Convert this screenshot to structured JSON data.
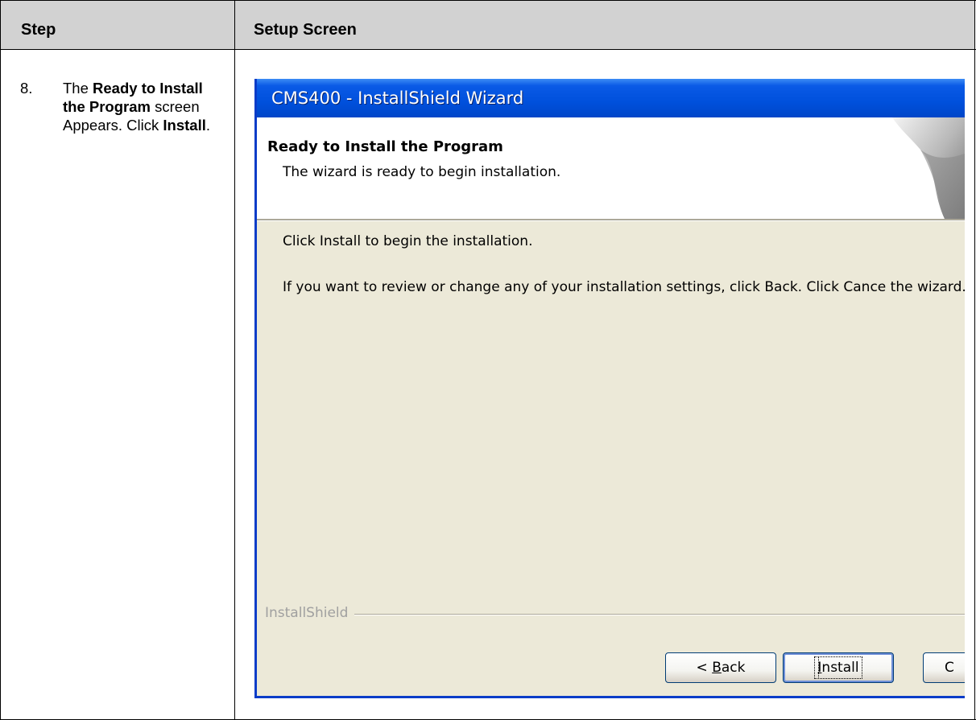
{
  "table": {
    "header": {
      "step": "Step",
      "setup_screen": "Setup Screen"
    },
    "row": {
      "number": "8.",
      "text_parts": [
        "The ",
        "Ready to Install the Program",
        " screen Appears. Click ",
        "Install",
        "."
      ]
    }
  },
  "wizard": {
    "title": "CMS400 - InstallShield Wizard",
    "banner_title": "Ready to Install the Program",
    "banner_subtitle": "The wizard is ready to begin installation.",
    "body_line1": "Click Install to begin the installation.",
    "body_line2": "If you want to review or change any of your installation settings, click Back. Click Cance the wizard.",
    "footer_brand": "InstallShield",
    "buttons": {
      "back": {
        "prefix": "< ",
        "accel": "B",
        "rest": "ack"
      },
      "install": {
        "accel": "I",
        "rest": "nstall"
      },
      "cancel": "C"
    }
  }
}
